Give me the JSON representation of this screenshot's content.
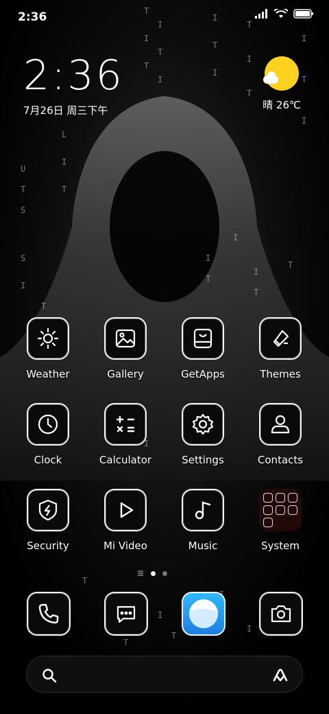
{
  "status_bar": {
    "time": "2:36"
  },
  "clock_widget": {
    "time": "2:36",
    "date": "7月26日 周三下午"
  },
  "weather_widget": {
    "text": "晴 26℃"
  },
  "apps": [
    {
      "label": "Weather",
      "icon": "sun-icon"
    },
    {
      "label": "Gallery",
      "icon": "image-icon"
    },
    {
      "label": "GetApps",
      "icon": "store-icon"
    },
    {
      "label": "Themes",
      "icon": "brush-icon"
    },
    {
      "label": "Clock",
      "icon": "clock-icon"
    },
    {
      "label": "Calculator",
      "icon": "calculator-icon"
    },
    {
      "label": "Settings",
      "icon": "gear-icon"
    },
    {
      "label": "Contacts",
      "icon": "person-icon"
    },
    {
      "label": "Security",
      "icon": "shield-bolt-icon"
    },
    {
      "label": "Mi Video",
      "icon": "play-icon"
    },
    {
      "label": "Music",
      "icon": "music-note-icon"
    },
    {
      "label": "System",
      "icon": "folder-icon"
    }
  ],
  "dock": [
    {
      "name": "phone",
      "icon": "phone-icon"
    },
    {
      "name": "messages",
      "icon": "message-icon"
    },
    {
      "name": "browser",
      "icon": "browser-icon"
    },
    {
      "name": "camera",
      "icon": "camera-icon"
    }
  ],
  "page_indicator": {
    "current": 2,
    "total": 2
  },
  "search_bar": {
    "left_icon": "search-icon",
    "right_icon": "mi-logo-icon"
  },
  "colors": {
    "sun": "#ffd21f",
    "browser": "#2e9bf0",
    "folder_bg": "#2a0a0a"
  }
}
